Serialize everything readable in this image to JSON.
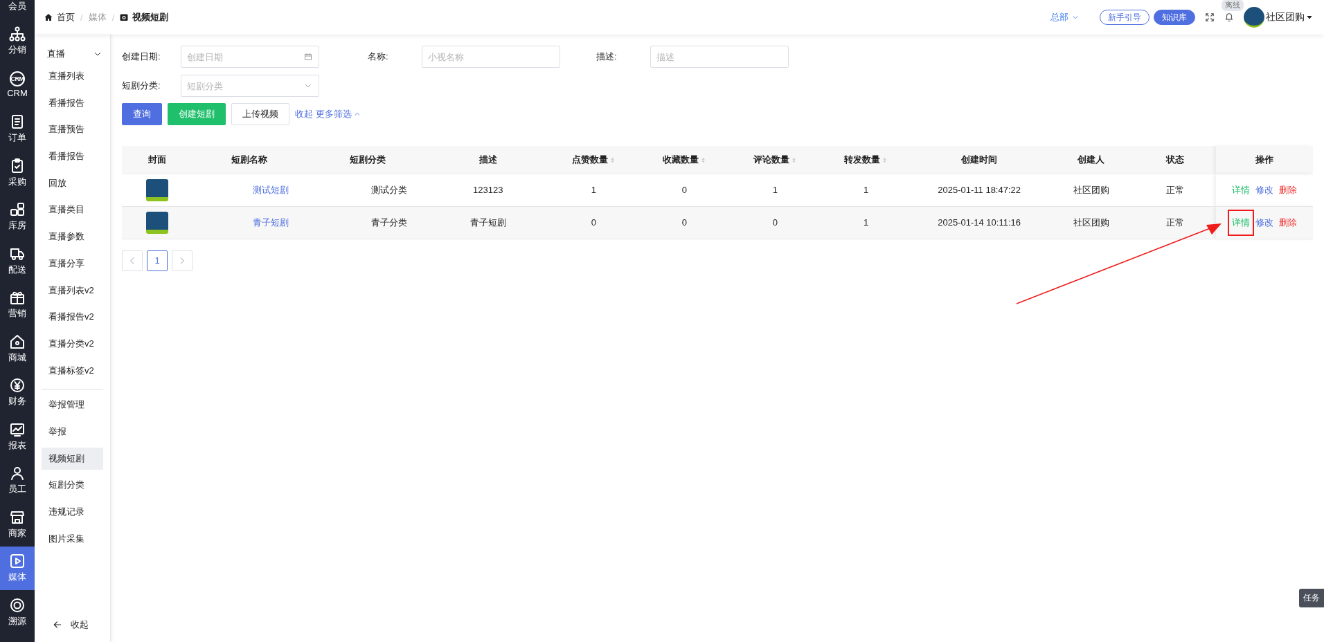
{
  "rail": {
    "items": [
      {
        "label": "会员",
        "selected": false
      },
      {
        "label": "分销",
        "selected": false
      },
      {
        "label": "CRM",
        "icon_text": "CRM",
        "selected": false
      },
      {
        "label": "订单",
        "selected": false
      },
      {
        "label": "采购",
        "selected": false
      },
      {
        "label": "库房",
        "selected": false
      },
      {
        "label": "配送",
        "selected": false
      },
      {
        "label": "营销",
        "selected": false
      },
      {
        "label": "商城",
        "selected": false
      },
      {
        "label": "财务",
        "selected": false
      },
      {
        "label": "报表",
        "selected": false
      },
      {
        "label": "员工",
        "selected": false
      },
      {
        "label": "商家",
        "selected": false
      },
      {
        "label": "媒体",
        "selected": true
      },
      {
        "label": "溯源",
        "selected": false
      }
    ]
  },
  "sidebar": {
    "groups": [
      {
        "label": "直播",
        "expanded": true,
        "children": [
          {
            "label": "直播列表",
            "selected": false
          },
          {
            "label": "看播报告",
            "selected": false
          },
          {
            "label": "直播预告",
            "selected": false
          },
          {
            "label": "看播报告",
            "selected": false
          },
          {
            "label": "回放",
            "selected": false
          },
          {
            "label": "直播类目",
            "selected": false
          },
          {
            "label": "直播参数",
            "selected": false
          },
          {
            "label": "直播分享",
            "selected": false
          },
          {
            "label": "直播列表v2",
            "selected": false
          },
          {
            "label": "看播报告v2",
            "selected": false
          },
          {
            "label": "直播分类v2",
            "selected": false
          },
          {
            "label": "直播标签v2",
            "selected": false
          }
        ]
      },
      {
        "children": [
          {
            "label": "举报管理",
            "selected": false
          },
          {
            "label": "举报",
            "selected": false
          },
          {
            "label": "视频短剧",
            "selected": true
          },
          {
            "label": "短剧分类",
            "selected": false
          },
          {
            "label": "违规记录",
            "selected": false
          },
          {
            "label": "图片采集",
            "selected": false
          }
        ]
      }
    ],
    "collapse": "收起"
  },
  "breadcrumb": [
    {
      "label": "首页",
      "kind": "home"
    },
    {
      "separator": "/",
      "label": "媒体",
      "kind": "plain"
    },
    {
      "separator": "/",
      "label": "视频短剧",
      "kind": "current"
    }
  ],
  "header": {
    "org": "总部",
    "guide": "新手引导",
    "knowledge": "知识库",
    "offline_badge": "离线",
    "user": "社区团购"
  },
  "filters": [
    {
      "label": "创建日期:",
      "placeholder": "创建日期",
      "kind": "date"
    },
    {
      "label": "名称:",
      "placeholder": "小视名称",
      "kind": "text"
    },
    {
      "label": "描述:",
      "placeholder": "描述",
      "kind": "text"
    },
    {
      "label": "短剧分类:",
      "placeholder": "短剧分类",
      "kind": "select"
    }
  ],
  "buttons": [
    {
      "label": "查询",
      "kind": "primary"
    },
    {
      "label": "创建短剧",
      "kind": "success"
    },
    {
      "label": "上传视频",
      "kind": "default"
    }
  ],
  "more_filters": {
    "collapse": "收起",
    "more": "更多筛选"
  },
  "table": {
    "columns": [
      {
        "label": "封面",
        "sortable": false
      },
      {
        "label": "短剧名称",
        "sortable": false
      },
      {
        "label": "短剧分类",
        "sortable": false
      },
      {
        "label": "描述",
        "sortable": false
      },
      {
        "label": "点赞数量",
        "sortable": true
      },
      {
        "label": "收藏数量",
        "sortable": true
      },
      {
        "label": "评论数量",
        "sortable": true
      },
      {
        "label": "转发数量",
        "sortable": true
      },
      {
        "label": "创建时间",
        "sortable": false
      },
      {
        "label": "创建人",
        "sortable": false
      },
      {
        "label": "状态",
        "sortable": false
      },
      {
        "label": "操作",
        "sortable": false
      }
    ],
    "rows": [
      {
        "name": "测试短剧",
        "category": "测试分类",
        "description": "123123",
        "likes": "1",
        "favorites": "0",
        "comments": "1",
        "shares": "1",
        "created": "2025-01-11 18:47:22",
        "creator": "社区团购",
        "status": "正常",
        "actions": [
          {
            "label": "详情",
            "kind": "detail",
            "highlighted": false
          },
          {
            "label": "修改",
            "kind": "edit",
            "highlighted": false
          },
          {
            "label": "删除",
            "kind": "delete",
            "highlighted": false
          }
        ]
      },
      {
        "name": "青子短剧",
        "category": "青子分类",
        "description": "青子短剧",
        "likes": "0",
        "favorites": "0",
        "comments": "0",
        "shares": "1",
        "created": "2025-01-14 10:11:16",
        "creator": "社区团购",
        "status": "正常",
        "actions": [
          {
            "label": "详情",
            "kind": "detail",
            "highlighted": true
          },
          {
            "label": "修改",
            "kind": "edit",
            "highlighted": false
          },
          {
            "label": "删除",
            "kind": "delete",
            "highlighted": false
          }
        ]
      }
    ]
  },
  "pagination": {
    "pages": [
      {
        "label": "1",
        "selected": true
      }
    ]
  },
  "task_button": "任务"
}
